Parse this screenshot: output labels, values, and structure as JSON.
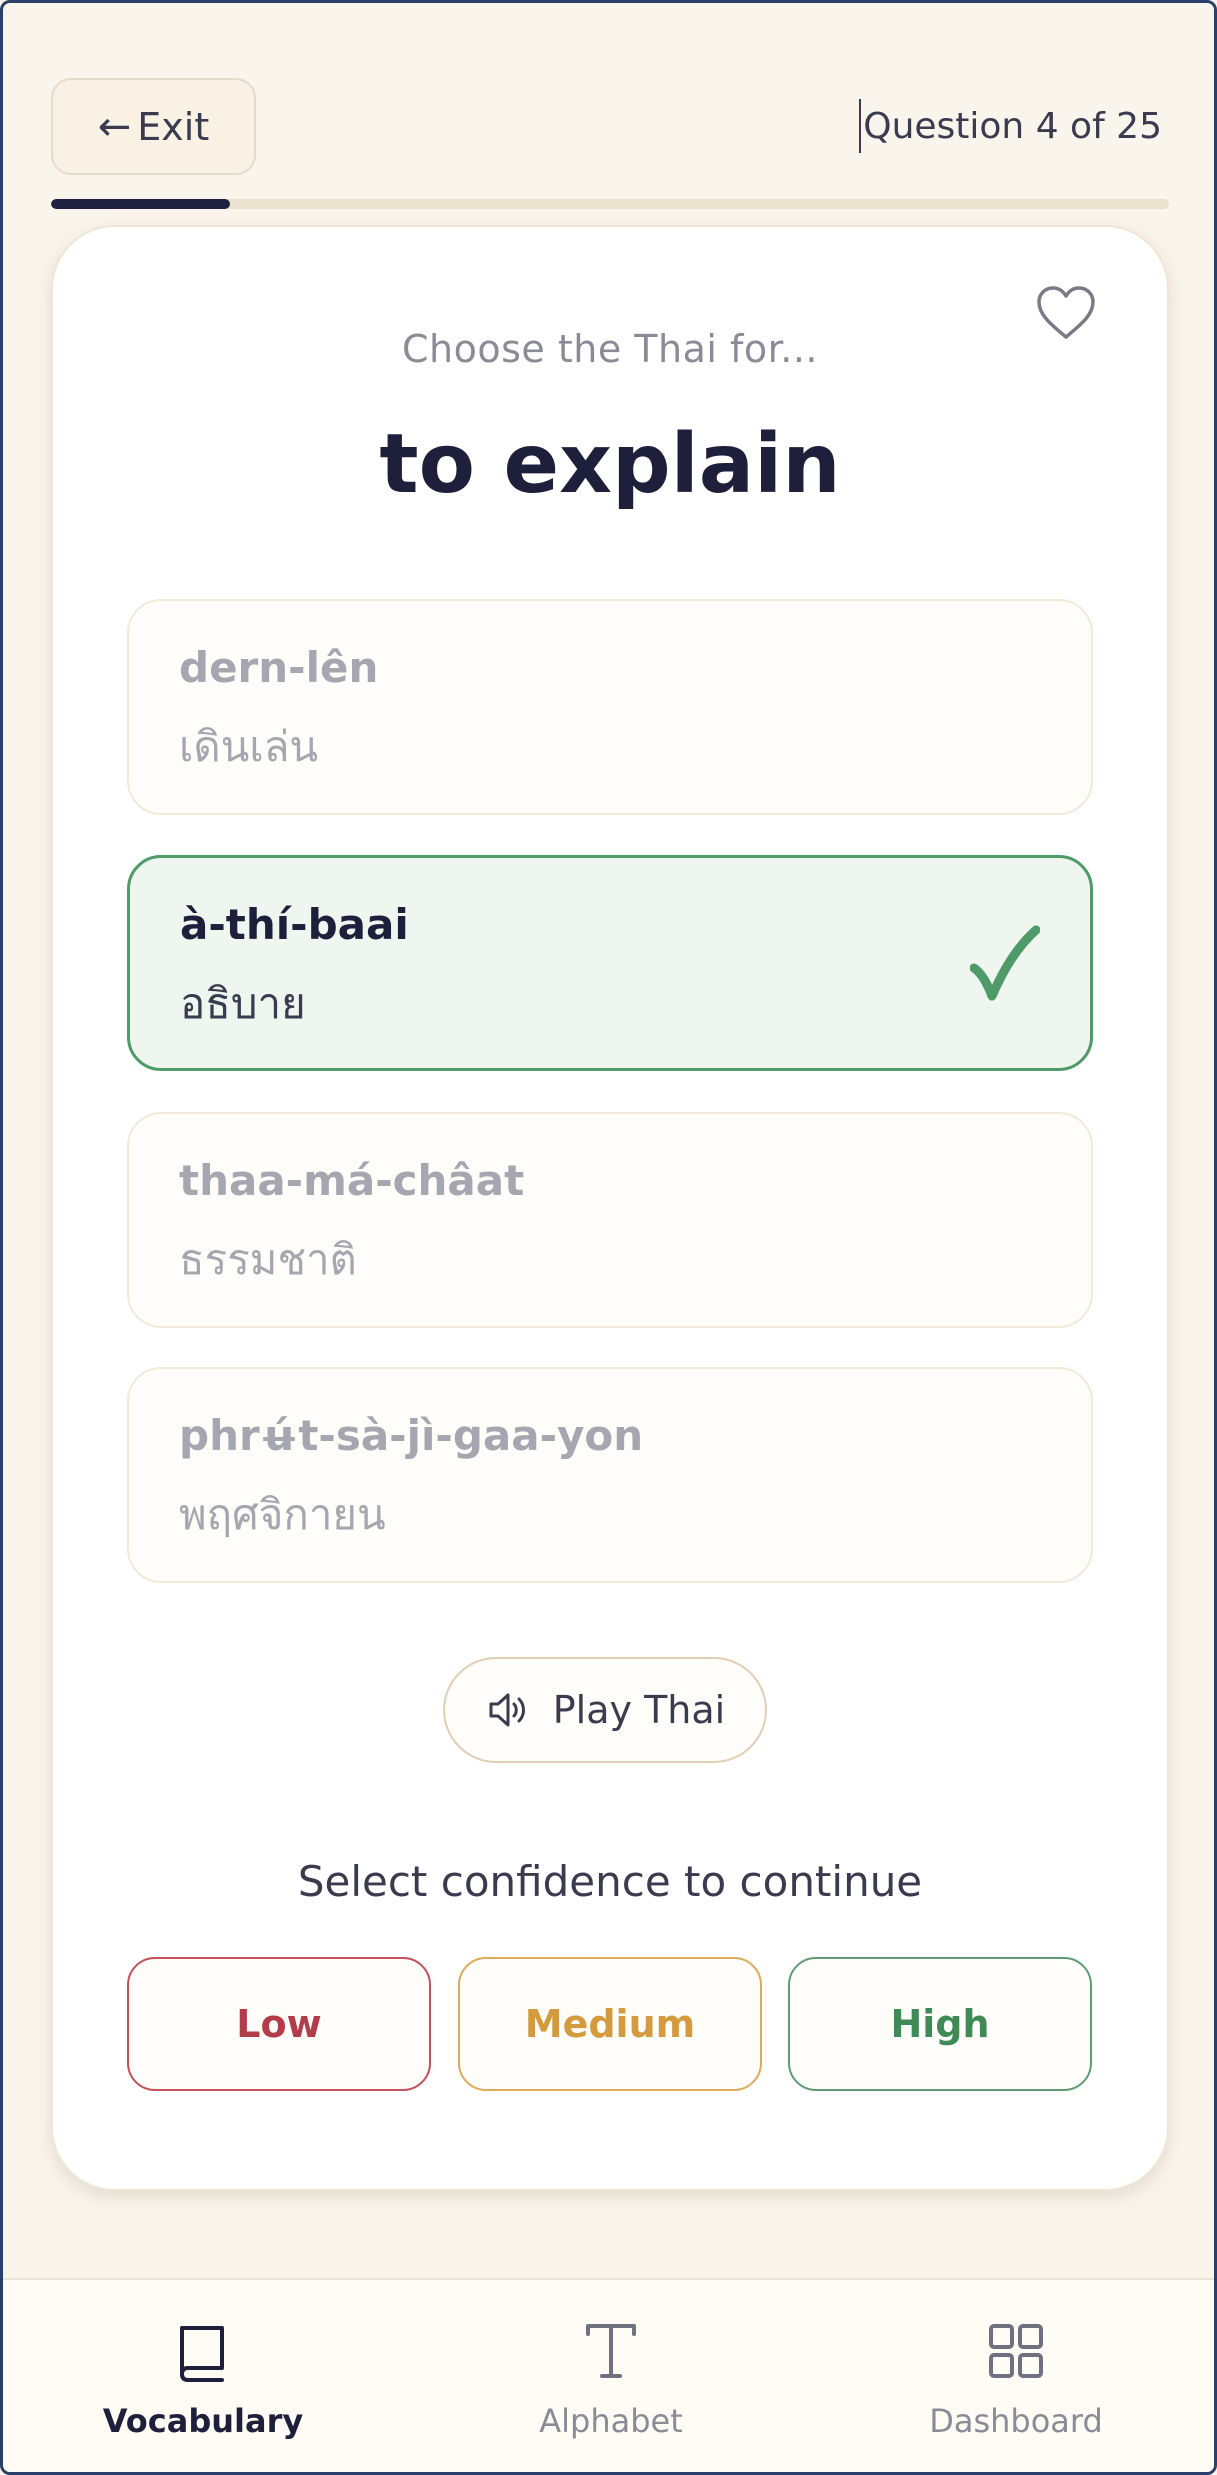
{
  "header": {
    "exit_label": "Exit",
    "exit_arrow": "←",
    "question_counter": "Question 4 of 25",
    "progress_fraction": 0.16
  },
  "quiz": {
    "prompt": "Choose the Thai for...",
    "word": "to explain",
    "favorite_icon": "heart-icon",
    "options": [
      {
        "roman": "dern-lên",
        "thai": "เดินเล่น",
        "state": "dimmed"
      },
      {
        "roman": "à-thí-baai",
        "thai": "อธิบาย",
        "state": "correct"
      },
      {
        "roman": "thaa-má-châat",
        "thai": "ธรรมชาติ",
        "state": "dimmed"
      },
      {
        "roman": "phrʉ́t-sà-jì-gaa-yon",
        "thai": "พฤศจิกายน",
        "state": "dimmed"
      }
    ],
    "play_label": "Play Thai",
    "confidence_prompt": "Select confidence to continue",
    "confidence": {
      "low": "Low",
      "medium": "Medium",
      "high": "High"
    }
  },
  "nav": {
    "items": [
      {
        "label": "Vocabulary",
        "icon": "book-icon",
        "active": true
      },
      {
        "label": "Alphabet",
        "icon": "text-t-icon",
        "active": false
      },
      {
        "label": "Dashboard",
        "icon": "grid-icon",
        "active": false
      }
    ]
  },
  "colors": {
    "background": "#faf5ec",
    "accent_dark": "#1f2140",
    "correct_green": "#4e9a68",
    "low_red": "#b23d48",
    "medium_amber": "#d49a3e",
    "high_green": "#3f8a56"
  }
}
